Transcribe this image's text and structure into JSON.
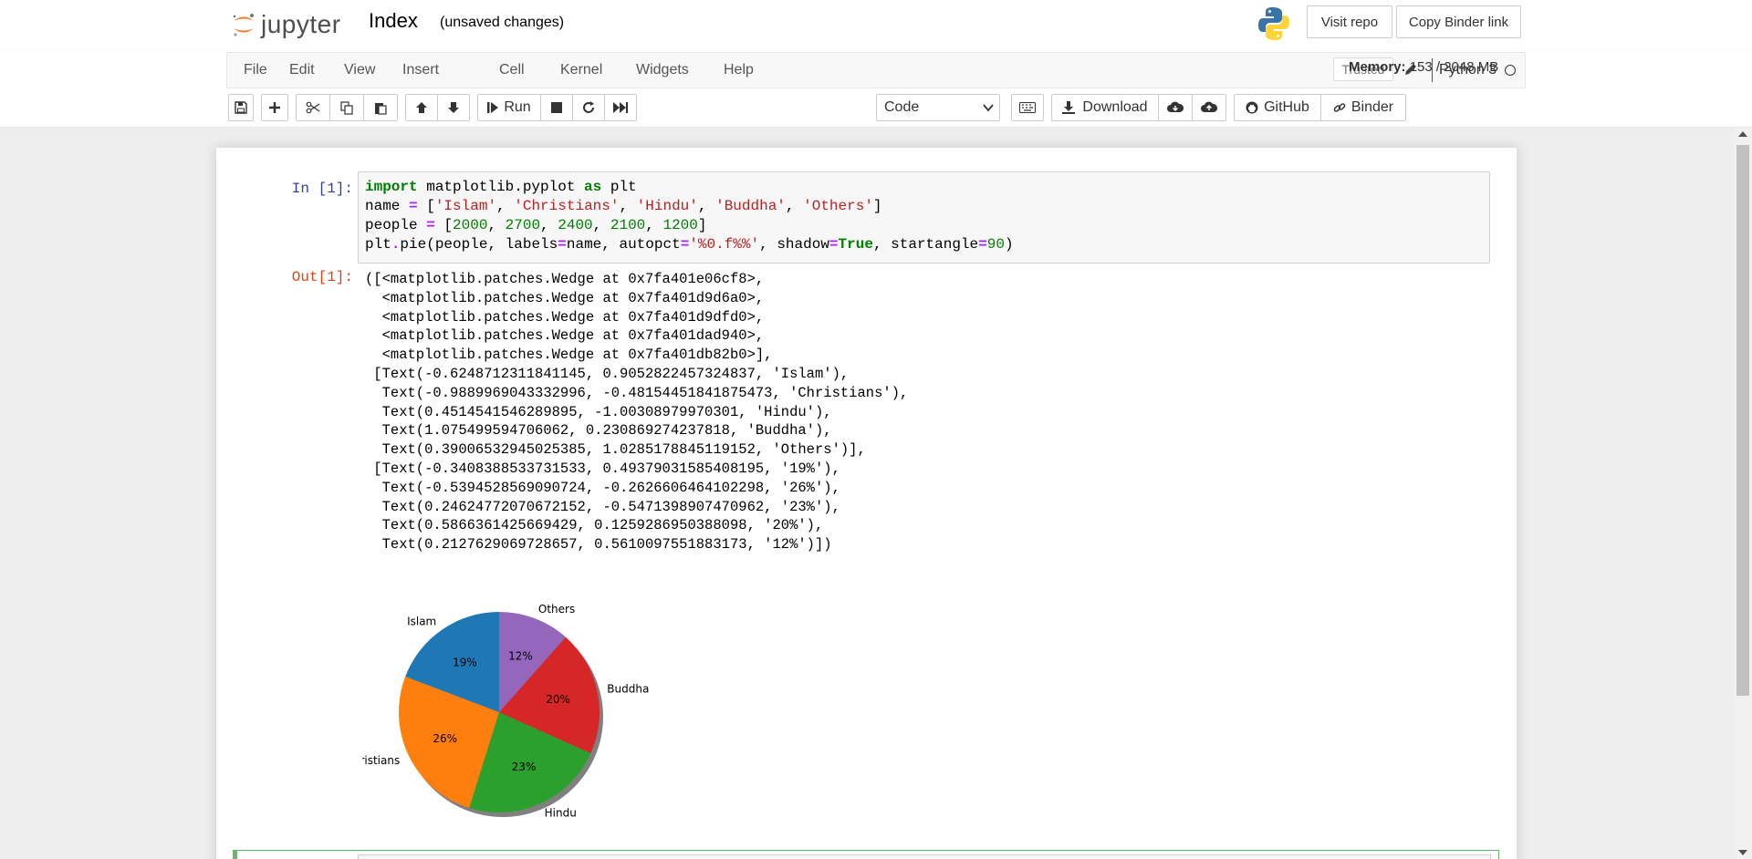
{
  "header": {
    "logo_text": "jupyter",
    "notebook_title": "Index",
    "save_status": "(unsaved changes)",
    "visit_repo_label": "Visit repo",
    "copy_binder_label": "Copy Binder link"
  },
  "menubar": {
    "items": [
      "File",
      "Edit",
      "View",
      "Insert",
      "Cell",
      "Kernel",
      "Widgets",
      "Help"
    ],
    "trusted_label": "Trusted",
    "kernel_name": "Python 3"
  },
  "toolbar": {
    "run_label": "Run",
    "cell_type": "Code",
    "download_label": "Download",
    "github_label": "GitHub",
    "binder_label": "Binder",
    "memory_label": "Memory:",
    "memory_value": "153 / 2048 MB"
  },
  "cell": {
    "in_prompt": "In [1]:",
    "out_prompt": "Out[1]:",
    "code_lines": [
      "import matplotlib.pyplot as plt",
      "name = ['Islam', 'Christians', 'Hindu', 'Buddha', 'Others']",
      "people = [2000, 2700, 2400, 2100, 1200]",
      "plt.pie(people, labels=name, autopct='%0.f%%', shadow=True, startangle=90)"
    ],
    "output_lines": [
      "([<matplotlib.patches.Wedge at 0x7fa401e06cf8>,",
      "  <matplotlib.patches.Wedge at 0x7fa401d9d6a0>,",
      "  <matplotlib.patches.Wedge at 0x7fa401d9dfd0>,",
      "  <matplotlib.patches.Wedge at 0x7fa401dad940>,",
      "  <matplotlib.patches.Wedge at 0x7fa401db82b0>],",
      " [Text(-0.6248712311841145, 0.9052822457324837, 'Islam'),",
      "  Text(-0.9889969043332996, -0.48154451841875473, 'Christians'),",
      "  Text(0.4514541546289895, -1.00308979970301, 'Hindu'),",
      "  Text(1.075499594706062, 0.230869274237818, 'Buddha'),",
      "  Text(0.39006532945025385, 1.0285178845119152, 'Others')],",
      " [Text(-0.3408388533731533, 0.49379031585408195, '19%'),",
      "  Text(-0.5394528569090724, -0.2626606464102298, '26%'),",
      "  Text(0.24624772070672152, -0.5471398907470962, '23%'),",
      "  Text(0.5866361425669429, 0.1259286950388098, '20%'),",
      "  Text(0.2127629069728657, 0.5610097551883173, '12%')])"
    ]
  },
  "chart_data": {
    "type": "pie",
    "categories": [
      "Islam",
      "Christians",
      "Hindu",
      "Buddha",
      "Others"
    ],
    "values": [
      2000,
      2700,
      2400,
      2100,
      1200
    ],
    "pct_labels": [
      "19%",
      "26%",
      "23%",
      "20%",
      "12%"
    ],
    "colors": [
      "#1f77b4",
      "#ff7f0e",
      "#2ca02c",
      "#d62728",
      "#9467bd"
    ],
    "start_angle_deg": 90,
    "shadow": true,
    "title": ""
  }
}
